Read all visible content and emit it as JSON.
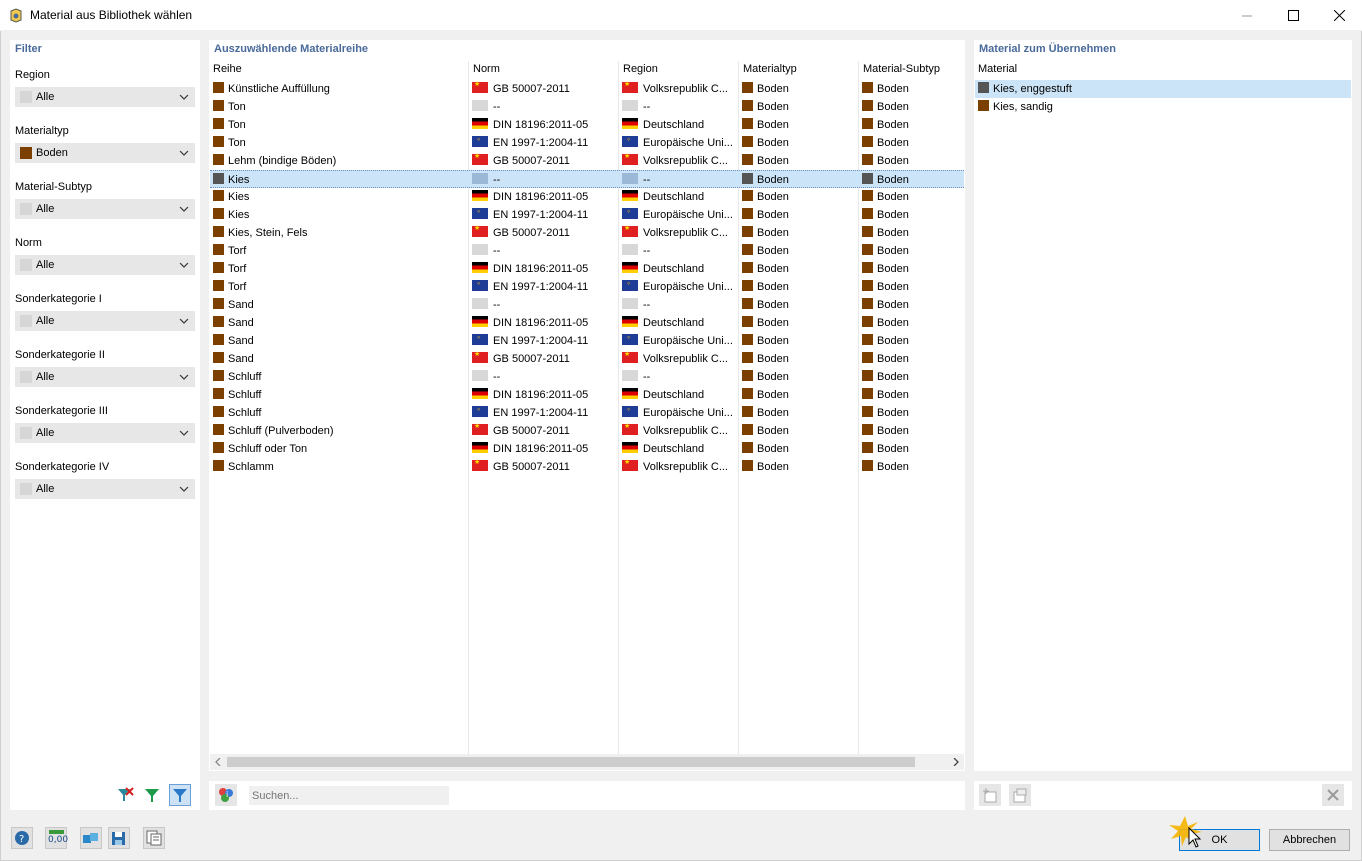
{
  "window": {
    "title": "Material aus Bibliothek wählen"
  },
  "filter": {
    "title": "Filter",
    "fields": [
      {
        "label": "Region",
        "value": "Alle",
        "swatch": "#d6d6d6"
      },
      {
        "label": "Materialtyp",
        "value": "Boden",
        "swatch": "#7b3f00"
      },
      {
        "label": "Material-Subtyp",
        "value": "Alle",
        "swatch": "#d6d6d6"
      },
      {
        "label": "Norm",
        "value": "Alle",
        "swatch": "#d6d6d6"
      },
      {
        "label": "Sonderkategorie I",
        "value": "Alle",
        "swatch": "#d6d6d6"
      },
      {
        "label": "Sonderkategorie II",
        "value": "Alle",
        "swatch": "#d6d6d6"
      },
      {
        "label": "Sonderkategorie III",
        "value": "Alle",
        "swatch": "#d6d6d6"
      },
      {
        "label": "Sonderkategorie IV",
        "value": "Alle",
        "swatch": "#d6d6d6"
      }
    ]
  },
  "materials": {
    "title": "Auszuwählende Materialreihe",
    "columns": [
      "Reihe",
      "Norm",
      "Region",
      "Materialtyp",
      "Material-Subtyp"
    ],
    "rows": [
      {
        "reihe": "Künstliche Auffüllung",
        "norm": "GB 50007-2011",
        "flag": "cn",
        "region": "Volksrepublik C...",
        "typ": "Boden",
        "subtyp": "Boden"
      },
      {
        "reihe": "Ton",
        "norm": "--",
        "flag": "none",
        "region": "--",
        "typ": "Boden",
        "subtyp": "Boden"
      },
      {
        "reihe": "Ton",
        "norm": "DIN 18196:2011-05",
        "flag": "de",
        "region": "Deutschland",
        "typ": "Boden",
        "subtyp": "Boden"
      },
      {
        "reihe": "Ton",
        "norm": "EN 1997-1:2004-11",
        "flag": "eu",
        "region": "Europäische Uni...",
        "typ": "Boden",
        "subtyp": "Boden"
      },
      {
        "reihe": "Lehm (bindige Böden)",
        "norm": "GB 50007-2011",
        "flag": "cn",
        "region": "Volksrepublik C...",
        "typ": "Boden",
        "subtyp": "Boden"
      },
      {
        "reihe": "Kies",
        "norm": "--",
        "flag": "none",
        "region": "--",
        "typ": "Boden",
        "subtyp": "Boden",
        "selected": true
      },
      {
        "reihe": "Kies",
        "norm": "DIN 18196:2011-05",
        "flag": "de",
        "region": "Deutschland",
        "typ": "Boden",
        "subtyp": "Boden"
      },
      {
        "reihe": "Kies",
        "norm": "EN 1997-1:2004-11",
        "flag": "eu",
        "region": "Europäische Uni...",
        "typ": "Boden",
        "subtyp": "Boden"
      },
      {
        "reihe": "Kies, Stein, Fels",
        "norm": "GB 50007-2011",
        "flag": "cn",
        "region": "Volksrepublik C...",
        "typ": "Boden",
        "subtyp": "Boden"
      },
      {
        "reihe": "Torf",
        "norm": "--",
        "flag": "none",
        "region": "--",
        "typ": "Boden",
        "subtyp": "Boden"
      },
      {
        "reihe": "Torf",
        "norm": "DIN 18196:2011-05",
        "flag": "de",
        "region": "Deutschland",
        "typ": "Boden",
        "subtyp": "Boden"
      },
      {
        "reihe": "Torf",
        "norm": "EN 1997-1:2004-11",
        "flag": "eu",
        "region": "Europäische Uni...",
        "typ": "Boden",
        "subtyp": "Boden"
      },
      {
        "reihe": "Sand",
        "norm": "--",
        "flag": "none",
        "region": "--",
        "typ": "Boden",
        "subtyp": "Boden"
      },
      {
        "reihe": "Sand",
        "norm": "DIN 18196:2011-05",
        "flag": "de",
        "region": "Deutschland",
        "typ": "Boden",
        "subtyp": "Boden"
      },
      {
        "reihe": "Sand",
        "norm": "EN 1997-1:2004-11",
        "flag": "eu",
        "region": "Europäische Uni...",
        "typ": "Boden",
        "subtyp": "Boden"
      },
      {
        "reihe": "Sand",
        "norm": "GB 50007-2011",
        "flag": "cn",
        "region": "Volksrepublik C...",
        "typ": "Boden",
        "subtyp": "Boden"
      },
      {
        "reihe": "Schluff",
        "norm": "--",
        "flag": "none",
        "region": "--",
        "typ": "Boden",
        "subtyp": "Boden"
      },
      {
        "reihe": "Schluff",
        "norm": "DIN 18196:2011-05",
        "flag": "de",
        "region": "Deutschland",
        "typ": "Boden",
        "subtyp": "Boden"
      },
      {
        "reihe": "Schluff",
        "norm": "EN 1997-1:2004-11",
        "flag": "eu",
        "region": "Europäische Uni...",
        "typ": "Boden",
        "subtyp": "Boden"
      },
      {
        "reihe": "Schluff (Pulverboden)",
        "norm": "GB 50007-2011",
        "flag": "cn",
        "region": "Volksrepublik C...",
        "typ": "Boden",
        "subtyp": "Boden"
      },
      {
        "reihe": "Schluff oder Ton",
        "norm": "DIN 18196:2011-05",
        "flag": "de",
        "region": "Deutschland",
        "typ": "Boden",
        "subtyp": "Boden"
      },
      {
        "reihe": "Schlamm",
        "norm": "GB 50007-2011",
        "flag": "cn",
        "region": "Volksrepublik C...",
        "typ": "Boden",
        "subtyp": "Boden"
      }
    ],
    "search_placeholder": "Suchen..."
  },
  "takeover": {
    "title": "Material zum Übernehmen",
    "column": "Material",
    "items": [
      {
        "label": "Kies, enggestuft",
        "selected": true
      },
      {
        "label": "Kies, sandig",
        "selected": false
      }
    ]
  },
  "buttons": {
    "ok": "OK",
    "cancel": "Abbrechen",
    "units_icon_text": "0,00"
  },
  "colors": {
    "soil": "#7b3f00",
    "selected_soil": "#555555",
    "accent_title": "#4a6a9a",
    "selection": "#cce4f7"
  }
}
